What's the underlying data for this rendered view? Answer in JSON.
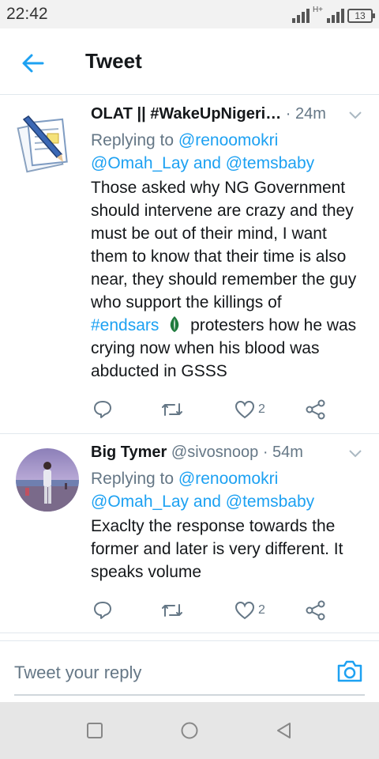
{
  "status_bar": {
    "time": "22:42",
    "network": "H+",
    "battery": "13"
  },
  "header": {
    "title": "Tweet"
  },
  "tweets": [
    {
      "name": "OLAT || #WakeUpNigeri…",
      "handle": "",
      "time": "· 24m",
      "replying_prefix": "Replying to",
      "replying_line1": "@renoomokri",
      "replying_line2_a": "@Omah_Lay",
      "replying_line2_and": "and",
      "replying_line2_b": "@temsbaby",
      "text_before": "Those asked why NG Government should intervene are crazy and they must be out of their mind, I want them to know that their time is also near, they should remember the guy who support the killings of",
      "hashtag": "#endsars",
      "text_after": "protesters how he was crying now when his blood was abducted in GSSS",
      "likes": "2",
      "avatar_icon": "notepad-pen-icon"
    },
    {
      "name": "Big Tymer",
      "handle": "@sivosnoop",
      "time": "· 54m",
      "replying_prefix": "Replying to",
      "replying_line1": "@renoomokri",
      "replying_line2_a": "@Omah_Lay",
      "replying_line2_and": "and",
      "replying_line2_b": "@temsbaby",
      "text": "Exaclty the response towards the former and later is very different. It speaks volume",
      "likes": "2",
      "avatar_icon": "beach-photo-avatar"
    }
  ],
  "reply_bar": {
    "placeholder": "Tweet your reply"
  },
  "colors": {
    "accent": "#1da1f2",
    "secondary_text": "#657786",
    "nav_bar": "#e6e6e6",
    "status_bar": "#f2f2f2"
  }
}
